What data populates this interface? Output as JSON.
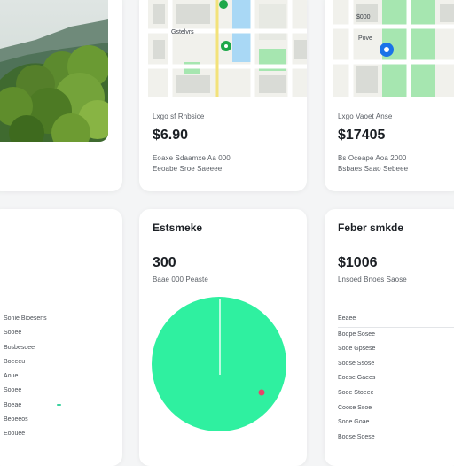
{
  "cards": [
    {
      "id": "landscape",
      "type": "image",
      "icon": "landscape-photo"
    },
    {
      "id": "map1",
      "map_label": "Gstelvrs",
      "map_label_2": "",
      "label": "Lxgo sf Rnbsice",
      "value": "$6.90",
      "sub": "Eoaxe Sdaamxe Aa 000",
      "sub2": "Eeoabe Sroe Saeeee"
    },
    {
      "id": "map2",
      "map_label": "$000",
      "map_label_2": "Pove",
      "label": "Lxgo Vaoet Anse",
      "value": "$17405",
      "sub": "Bs Oceape Aoa 2000",
      "sub2": "Bsbaes Saao Sebeee"
    }
  ],
  "left_list": {
    "items": [
      "Sonie Bioesens",
      "Sooee",
      "Bosbesoee",
      "Boeeeu",
      "Aoue",
      "Sooee",
      "Boeae",
      "Beoeeos",
      "Eoouee"
    ]
  },
  "chart_card": {
    "title": "Estsmeke",
    "value": "300",
    "sub": "Baae 000 Peaste",
    "colors": {
      "circle": "#2ff0a0",
      "marker": "#e8456a"
    }
  },
  "right_card": {
    "title": "Feber smkde",
    "value": "$1006",
    "sub": "Lnsoed Bnoes Saose",
    "list_head": "Eeaee",
    "list": [
      "Boope Sosee",
      "Sooe Gpsese",
      "Soose Ssose",
      "Eoose Gaees",
      "Sooe Stoeee",
      "Coose Ssoe",
      "Sooe Goae",
      "Boose Soese"
    ]
  },
  "colors": {
    "map_green": "#a6e6b0",
    "map_water": "#a9d8f5",
    "map_road": "#ffffff",
    "map_yellow": "#f3e27a",
    "pin_green": "#1ea84a",
    "pin_blue": "#1a73e8"
  }
}
